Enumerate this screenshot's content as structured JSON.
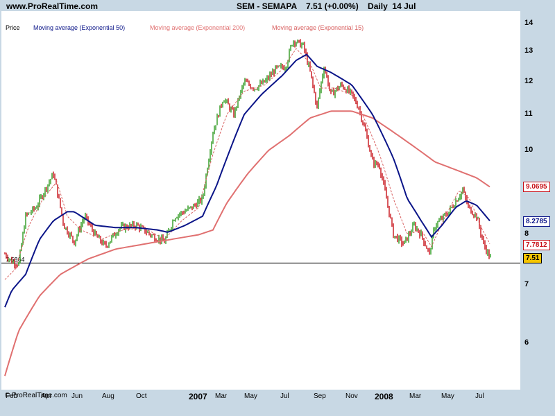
{
  "header": {
    "site": "www.ProRealTime.com",
    "title": "SEM - SEMAPA    7.51 (+0.00%)    Daily  14 Jul"
  },
  "legend": {
    "price": "Price",
    "ema50": "Moving average (Exponential 50)",
    "ema200": "Moving average (Exponential 200)",
    "ema15": "Moving average (Exponential 15)"
  },
  "copyright": "© ProRealTime.com",
  "colors": {
    "up": "#2e9a1e",
    "down": "#c8121a",
    "ema50": "#0a1488",
    "ema200": "#e07070",
    "ema15": "#d86060"
  },
  "chart_data": {
    "type": "candlestick",
    "y_ticks": [
      "14",
      "13",
      "12",
      "11",
      "10",
      "8",
      "7",
      "6"
    ],
    "x_labels": [
      {
        "label": "Feb",
        "bold": false
      },
      {
        "label": "Apr",
        "bold": false
      },
      {
        "label": "Jun",
        "bold": false
      },
      {
        "label": "Aug",
        "bold": false
      },
      {
        "label": "Oct",
        "bold": false
      },
      {
        "label": "2007",
        "bold": true
      },
      {
        "label": "Mar",
        "bold": false
      },
      {
        "label": "May",
        "bold": false
      },
      {
        "label": "Jul",
        "bold": false
      },
      {
        "label": "Sep",
        "bold": false
      },
      {
        "label": "Nov",
        "bold": false
      },
      {
        "label": "2008",
        "bold": true
      },
      {
        "label": "Mar",
        "bold": false
      },
      {
        "label": "May",
        "bold": false
      },
      {
        "label": "Jul",
        "bold": false
      }
    ],
    "price_path": [
      [
        0,
        7.6
      ],
      [
        10,
        7.45
      ],
      [
        20,
        7.4
      ],
      [
        30,
        8.4
      ],
      [
        45,
        8.6
      ],
      [
        70,
        9.4
      ],
      [
        85,
        8.2
      ],
      [
        100,
        7.85
      ],
      [
        115,
        8.4
      ],
      [
        130,
        8.0
      ],
      [
        145,
        7.75
      ],
      [
        165,
        8.15
      ],
      [
        190,
        8.2
      ],
      [
        210,
        8.0
      ],
      [
        230,
        7.85
      ],
      [
        245,
        8.4
      ],
      [
        270,
        8.6
      ],
      [
        285,
        8.8
      ],
      [
        300,
        10.5
      ],
      [
        315,
        11.5
      ],
      [
        330,
        11.0
      ],
      [
        345,
        12.0
      ],
      [
        360,
        11.8
      ],
      [
        375,
        12.0
      ],
      [
        390,
        12.4
      ],
      [
        405,
        12.5
      ],
      [
        415,
        13.4
      ],
      [
        430,
        13.2
      ],
      [
        440,
        12.3
      ],
      [
        450,
        11.2
      ],
      [
        460,
        12.5
      ],
      [
        470,
        11.6
      ],
      [
        485,
        11.9
      ],
      [
        500,
        11.6
      ],
      [
        510,
        11.2
      ],
      [
        520,
        10.5
      ],
      [
        530,
        9.7
      ],
      [
        540,
        9.6
      ],
      [
        550,
        8.8
      ],
      [
        560,
        8.0
      ],
      [
        575,
        7.8
      ],
      [
        590,
        8.2
      ],
      [
        600,
        8.0
      ],
      [
        612,
        7.6
      ],
      [
        620,
        8.2
      ],
      [
        640,
        8.5
      ],
      [
        660,
        9.0
      ],
      [
        668,
        8.6
      ],
      [
        680,
        8.4
      ],
      [
        690,
        7.8
      ],
      [
        700,
        7.51
      ]
    ],
    "ema50_path": [
      [
        0,
        6.6
      ],
      [
        10,
        6.9
      ],
      [
        30,
        7.2
      ],
      [
        50,
        7.9
      ],
      [
        70,
        8.3
      ],
      [
        90,
        8.5
      ],
      [
        100,
        8.5
      ],
      [
        130,
        8.2
      ],
      [
        160,
        8.15
      ],
      [
        190,
        8.15
      ],
      [
        220,
        8.1
      ],
      [
        235,
        8.05
      ],
      [
        260,
        8.2
      ],
      [
        285,
        8.4
      ],
      [
        305,
        9.1
      ],
      [
        320,
        9.8
      ],
      [
        345,
        11.0
      ],
      [
        370,
        11.6
      ],
      [
        400,
        12.2
      ],
      [
        420,
        12.7
      ],
      [
        435,
        12.9
      ],
      [
        450,
        12.5
      ],
      [
        470,
        12.3
      ],
      [
        500,
        11.9
      ],
      [
        530,
        11.0
      ],
      [
        560,
        9.8
      ],
      [
        580,
        8.8
      ],
      [
        600,
        8.3
      ],
      [
        615,
        7.95
      ],
      [
        630,
        8.2
      ],
      [
        650,
        8.6
      ],
      [
        665,
        8.75
      ],
      [
        680,
        8.65
      ],
      [
        700,
        8.28
      ]
    ],
    "ema200_path": [
      [
        0,
        5.5
      ],
      [
        20,
        6.2
      ],
      [
        50,
        6.8
      ],
      [
        80,
        7.2
      ],
      [
        120,
        7.5
      ],
      [
        160,
        7.7
      ],
      [
        200,
        7.8
      ],
      [
        240,
        7.9
      ],
      [
        280,
        8.0
      ],
      [
        300,
        8.1
      ],
      [
        320,
        8.7
      ],
      [
        350,
        9.4
      ],
      [
        380,
        10.0
      ],
      [
        410,
        10.4
      ],
      [
        440,
        10.9
      ],
      [
        470,
        11.1
      ],
      [
        500,
        11.1
      ],
      [
        530,
        10.9
      ],
      [
        560,
        10.5
      ],
      [
        590,
        10.1
      ],
      [
        620,
        9.7
      ],
      [
        650,
        9.5
      ],
      [
        680,
        9.3
      ],
      [
        700,
        9.07
      ]
    ],
    "ema15_path": [
      [
        0,
        7.1
      ],
      [
        15,
        7.3
      ],
      [
        35,
        8.2
      ],
      [
        55,
        8.8
      ],
      [
        75,
        9.2
      ],
      [
        90,
        8.4
      ],
      [
        110,
        8.1
      ],
      [
        140,
        7.9
      ],
      [
        170,
        8.1
      ],
      [
        200,
        8.15
      ],
      [
        230,
        7.9
      ],
      [
        255,
        8.3
      ],
      [
        280,
        8.6
      ],
      [
        300,
        9.9
      ],
      [
        320,
        11.0
      ],
      [
        345,
        11.7
      ],
      [
        375,
        11.9
      ],
      [
        400,
        12.4
      ],
      [
        420,
        13.1
      ],
      [
        440,
        12.6
      ],
      [
        455,
        11.8
      ],
      [
        475,
        11.8
      ],
      [
        500,
        11.6
      ],
      [
        520,
        10.8
      ],
      [
        540,
        9.9
      ],
      [
        560,
        8.8
      ],
      [
        580,
        8.0
      ],
      [
        600,
        8.1
      ],
      [
        615,
        7.75
      ],
      [
        635,
        8.4
      ],
      [
        655,
        9.0
      ],
      [
        670,
        8.8
      ],
      [
        685,
        8.2
      ],
      [
        700,
        7.78
      ]
    ],
    "hline": 7.42,
    "hline_label": "7.5864",
    "tags": [
      {
        "value": 9.07,
        "label": "9.0695",
        "fg": "#c8121a",
        "bg": "#ffffff",
        "border": "#c8121a"
      },
      {
        "value": 8.28,
        "label": "8.2785",
        "fg": "#0a1488",
        "bg": "#ffffff",
        "border": "#0a1488"
      },
      {
        "value": 7.78,
        "label": "7.7812",
        "fg": "#c8121a",
        "bg": "#ffffff",
        "border": "#c8121a"
      },
      {
        "value": 7.51,
        "label": "7.51",
        "fg": "#000000",
        "bg": "#f5c400",
        "border": "#000000"
      }
    ]
  }
}
